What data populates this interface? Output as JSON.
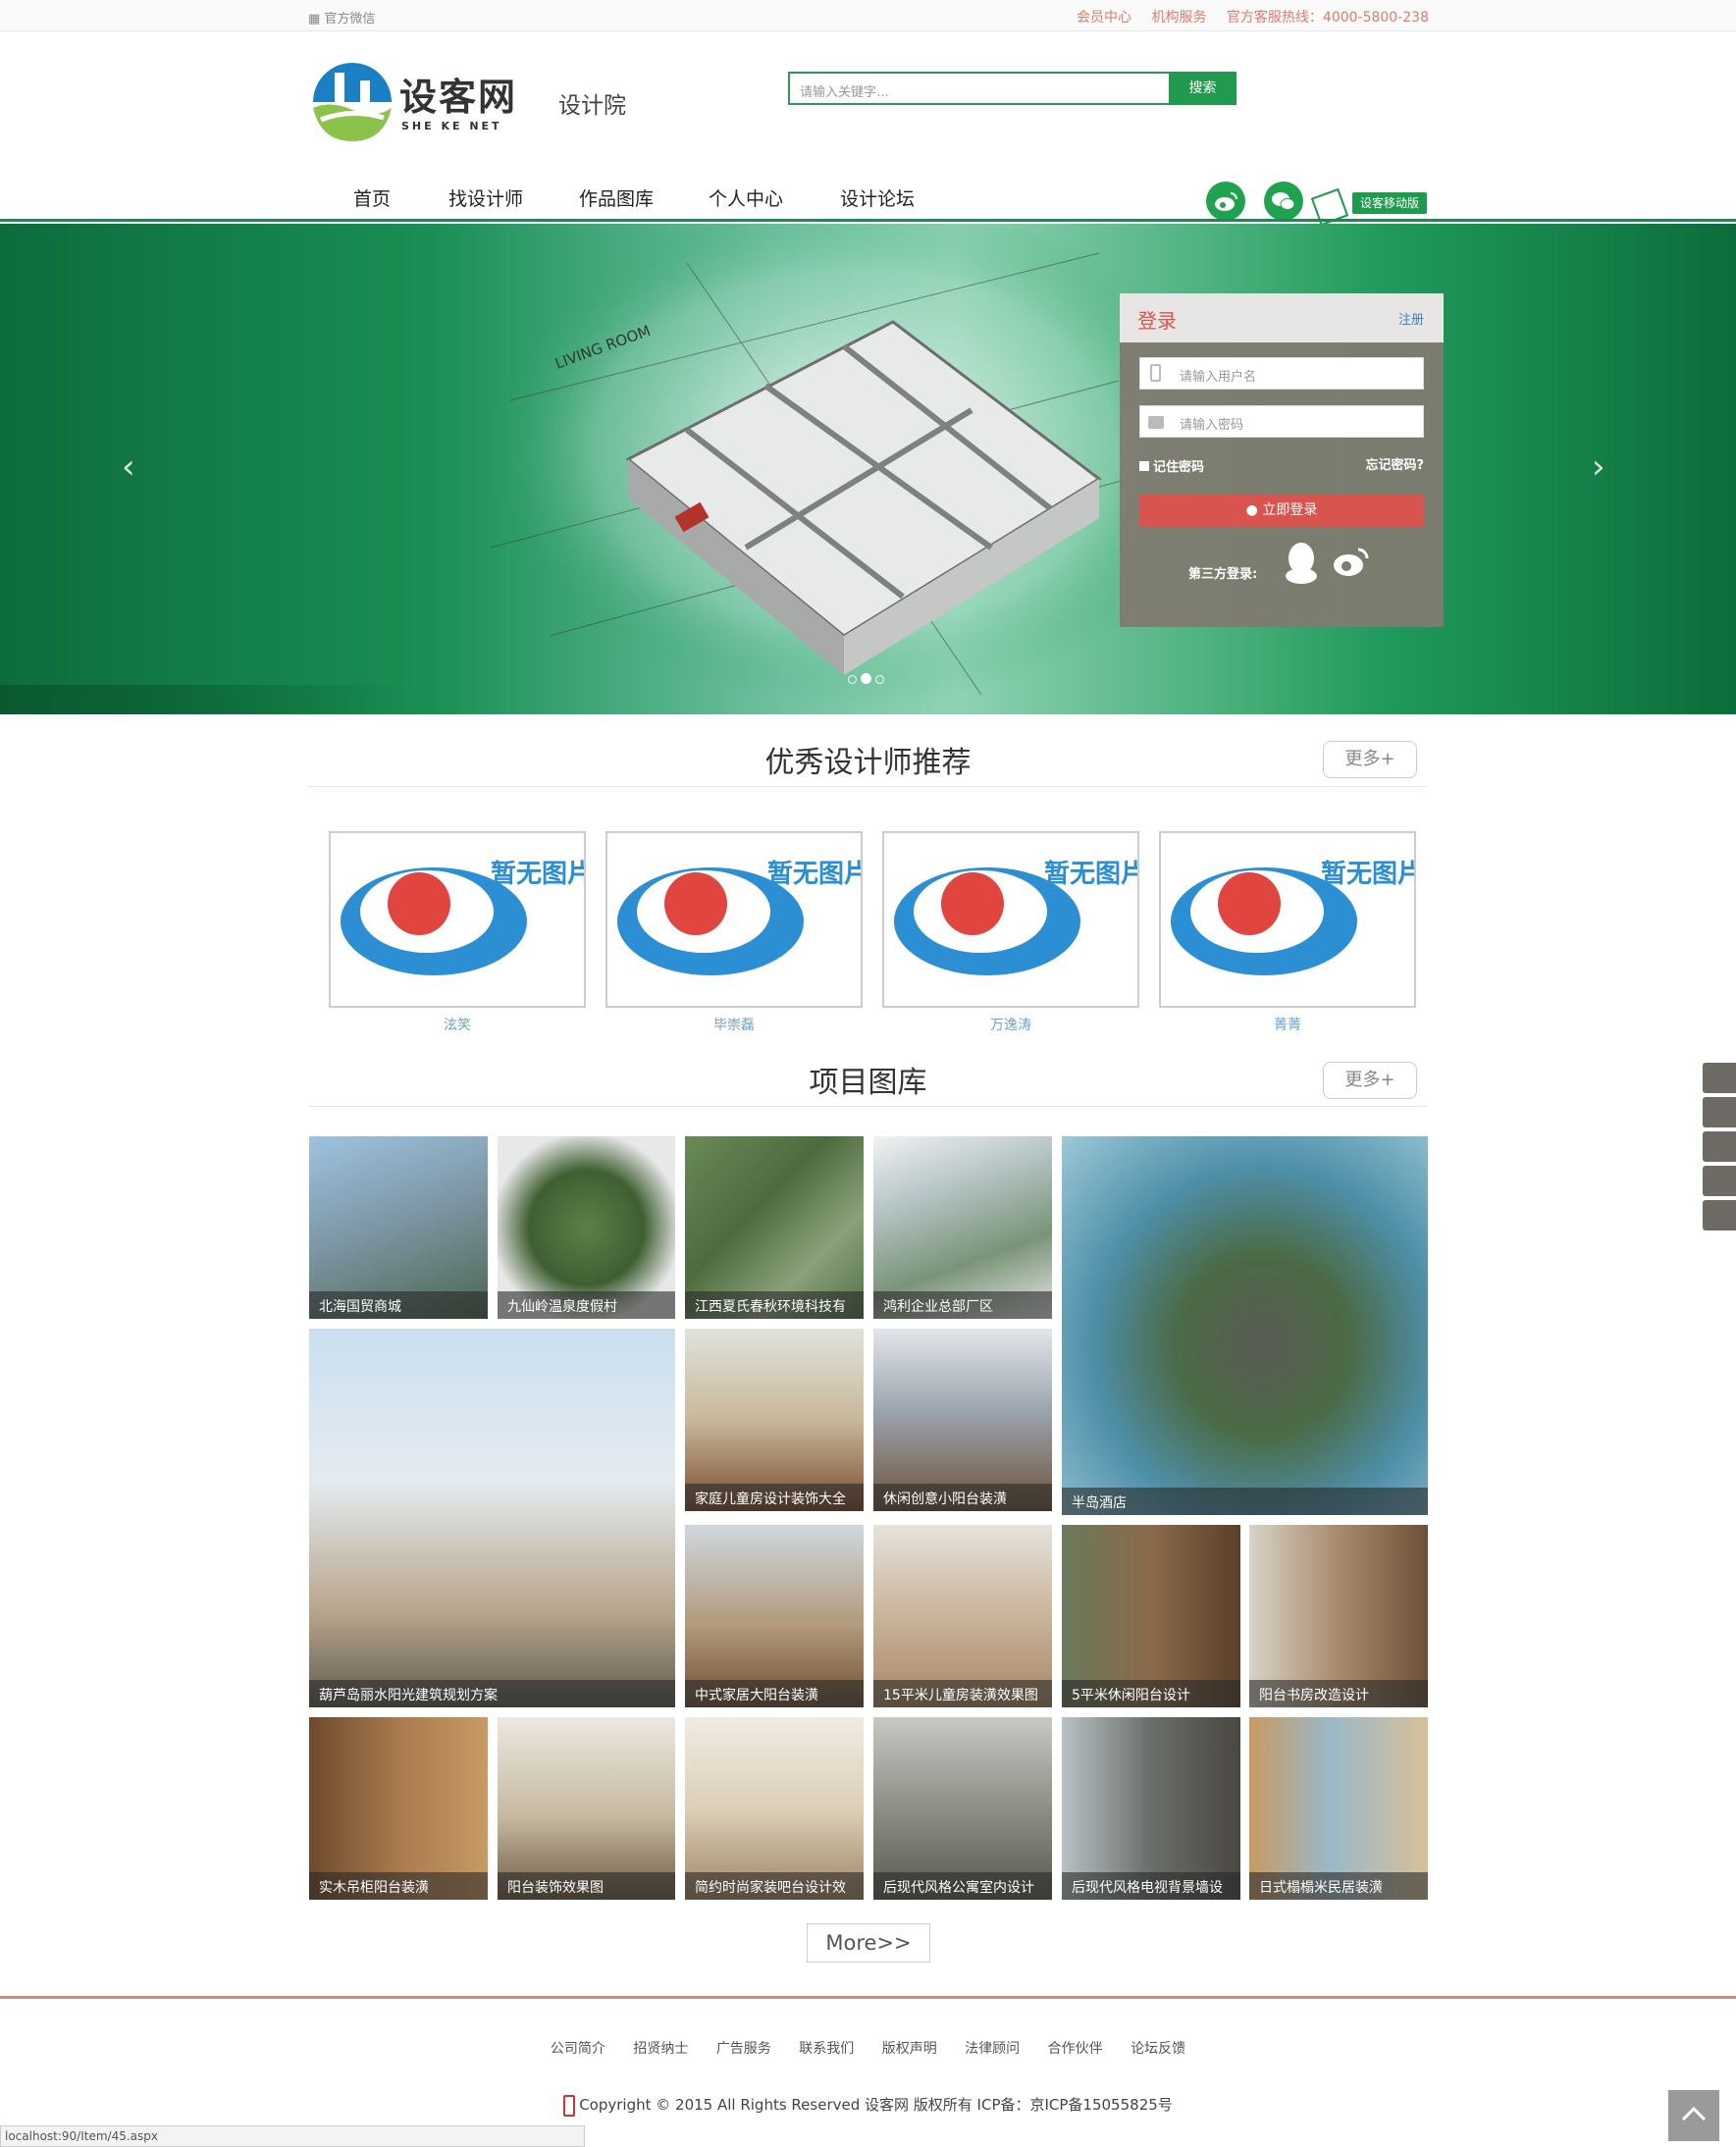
{
  "topbar": {
    "wechat": "官方微信",
    "member": "会员中心",
    "org": "机构服务",
    "hotline": "官方客服热线：4000-5800-238"
  },
  "logo": {
    "name": "设客网",
    "sub": "SHE KE NET",
    "section": "设计院"
  },
  "search": {
    "placeholder": "请输入关键字…",
    "button": "搜索"
  },
  "nav": [
    "首页",
    "找设计师",
    "作品图库",
    "个人中心",
    "设计论坛"
  ],
  "mobile_label": "设客移动版",
  "login": {
    "title": "登录",
    "register": "注册",
    "user_placeholder": "请输入用户名",
    "pass_placeholder": "请输入密码",
    "remember": "记住密码",
    "forgot": "忘记密码?",
    "submit": "立即登录",
    "third_party": "第三方登录:"
  },
  "designers": {
    "title": "优秀设计师推荐",
    "more": "更多+",
    "placeholder_text": "暂无图片",
    "items": [
      "泫笑",
      "毕崇磊",
      "万逸涛",
      "菁菁"
    ]
  },
  "gallery": {
    "title": "项目图库",
    "more": "更多+",
    "items": [
      "北海国贸商城",
      "九仙岭温泉度假村",
      "江西夏氏春秋环境科技有",
      "鸿利企业总部厂区",
      "半岛酒店",
      "葫芦岛丽水阳光建筑规划方案",
      "家庭儿童房设计装饰大全",
      "休闲创意小阳台装潢",
      "中式家居大阳台装潢",
      "15平米儿童房装潢效果图",
      "5平米休闲阳台设计",
      "阳台书房改造设计",
      "实木吊柜阳台装潢",
      "阳台装饰效果图",
      "简约时尚家装吧台设计效",
      "后现代风格公寓室内设计",
      "后现代风格电视背景墙设",
      "日式榻榻米民居装潢"
    ],
    "more_button": "More>>"
  },
  "footer": {
    "links": [
      "公司简介",
      "招贤纳士",
      "广告服务",
      "联系我们",
      "版权声明",
      "法律顾问",
      "合作伙伴",
      "论坛反馈"
    ],
    "copyright": "Copyright © 2015 All Rights Reserved 设客网 版权所有 ICP备：京ICP备15055825号"
  },
  "status_url": "localhost:90/Item/45.aspx",
  "colors": {
    "brand_green": "#1f9a4e",
    "accent_red": "#d9534f",
    "footer_line": "#c98b86"
  }
}
